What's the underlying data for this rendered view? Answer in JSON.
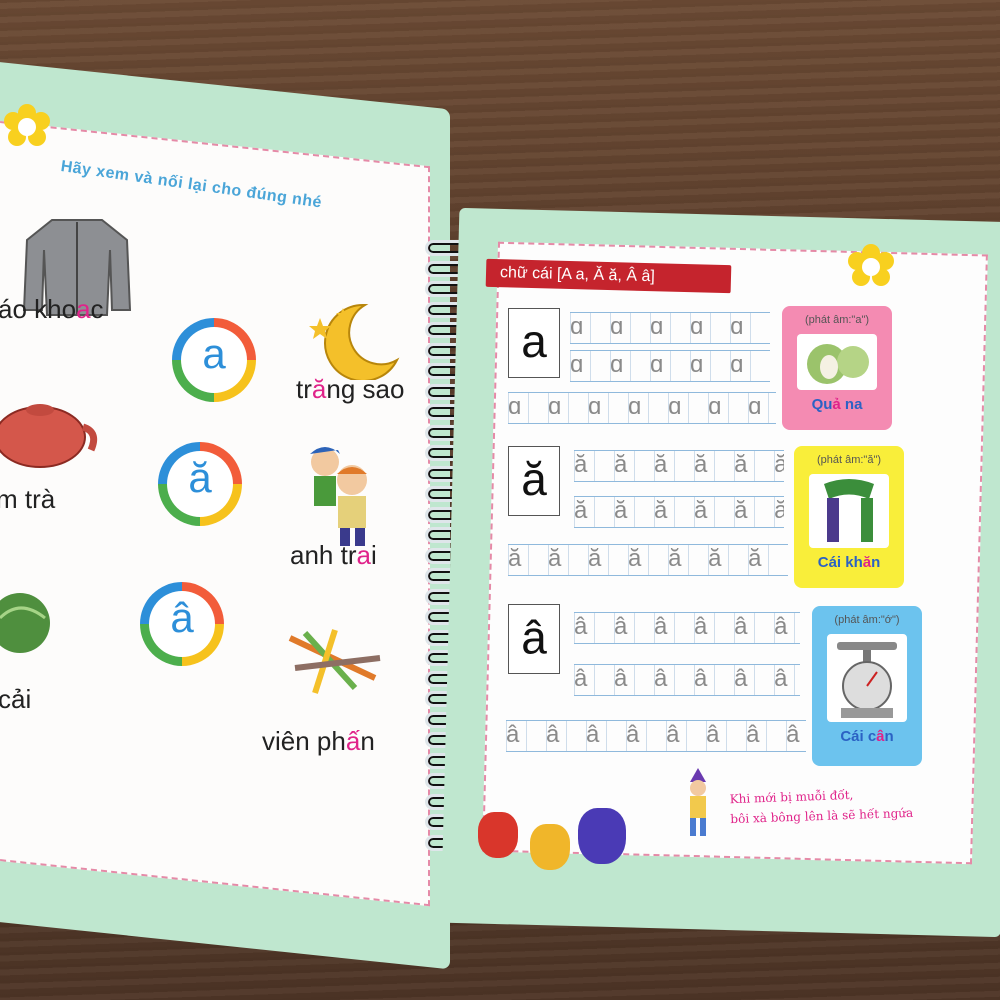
{
  "left_page": {
    "instruction": "Hãy xem và nối lại cho đúng nhé",
    "words": [
      {
        "text_pre": "áo kho",
        "hi": "a",
        "text_post": "c"
      },
      {
        "text_pre": "tr",
        "hi": "ă",
        "text_post": "ng sao"
      },
      {
        "text_pre": "m trà",
        "hi": "",
        "text_post": ""
      },
      {
        "text_pre": "anh tr",
        "hi": "a",
        "text_post": "i"
      },
      {
        "text_pre": "cải",
        "hi": "",
        "text_post": ""
      },
      {
        "text_pre": "viên ph",
        "hi": "ấ",
        "text_post": "n"
      }
    ],
    "ring_letters": [
      "a",
      "ă",
      "â"
    ]
  },
  "right_page": {
    "banner": "chữ cái  [A a, Ă ă, Â â]",
    "letters": [
      "a",
      "ă",
      "â"
    ],
    "trace_rows": [
      "ɑ ɑ ɑ ɑ ɑ ɑ ɑ ɑ",
      "ɑ ɑ ɑ ɑ ɑ ɑ ɑ ɑ",
      "ɑ ɑ ɑ ɑ ɑ ɑ ɑ ɑ ɑ",
      "ă ă ă ă ă ă ă ă",
      "ă ă ă ă ă ă ă ă",
      "ă ă ă ă ă ă ă ă ă",
      "â â â â â â â â",
      "â â â â â â â â",
      "â â â â â â â â â"
    ],
    "cards": [
      {
        "phonetic": "(phát âm:\"a\")",
        "name_pre": "Qu",
        "name_hi": "ả",
        "name_post": " na",
        "bg": "#f48bb2",
        "icon": "custard-apple-icon"
      },
      {
        "phonetic": "(phát âm:\"ă\")",
        "name_pre": "Cái kh",
        "name_hi": "ă",
        "name_post": "n",
        "bg": "#f9ee3a",
        "icon": "scarf-icon"
      },
      {
        "phonetic": "(phát âm:\"ớ\")",
        "name_pre": "Cái c",
        "name_hi": "â",
        "name_post": "n",
        "bg": "#6cc3ee",
        "icon": "scale-icon"
      }
    ],
    "note_line1": "Khi mới bị muỗi đốt,",
    "note_line2": "bôi xà bông lên là sẽ hết ngứa"
  }
}
